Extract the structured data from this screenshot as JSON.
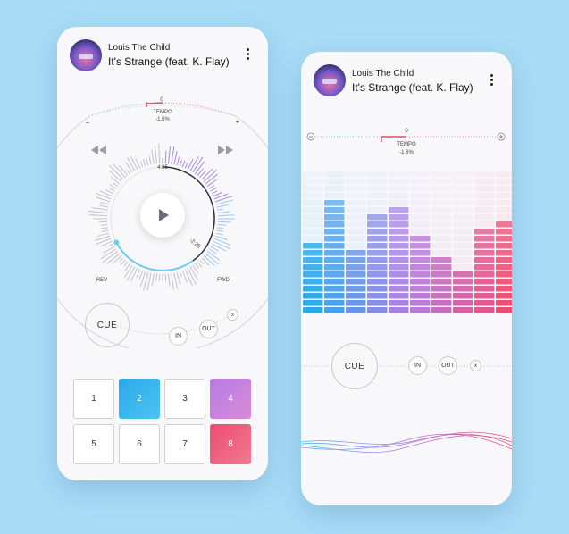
{
  "player1": {
    "artist": "Louis The Child",
    "track": "It's Strange (feat. K. Flay)",
    "tempo_zero": "0",
    "tempo_label": "TEMPO",
    "tempo_value": "-1.6%",
    "minus": "−",
    "plus": "+",
    "time_elapsed": "4:05",
    "time_remaining": "-2:25",
    "rev_label": "REV",
    "fwd_label": "FWD",
    "cue_label": "CUE",
    "in_label": "IN",
    "out_label": "OUT",
    "x_label": "x",
    "pads": [
      "1",
      "2",
      "3",
      "4",
      "5",
      "6",
      "7",
      "8"
    ]
  },
  "player2": {
    "artist": "Louis The Child",
    "track": "It's Strange (feat. K. Flay)",
    "tempo_zero": "0",
    "tempo_label": "TEMPO",
    "tempo_value": "-1.6%",
    "cue_label": "CUE",
    "in_label": "IN",
    "out_label": "OUT",
    "x_label": "x",
    "eq_levels": [
      10,
      16,
      9,
      14,
      15,
      11,
      8,
      6,
      12,
      13
    ]
  },
  "colors": {
    "blue": "#29a9ec",
    "purple": "#b57ce6",
    "pink": "#ec4c73"
  }
}
